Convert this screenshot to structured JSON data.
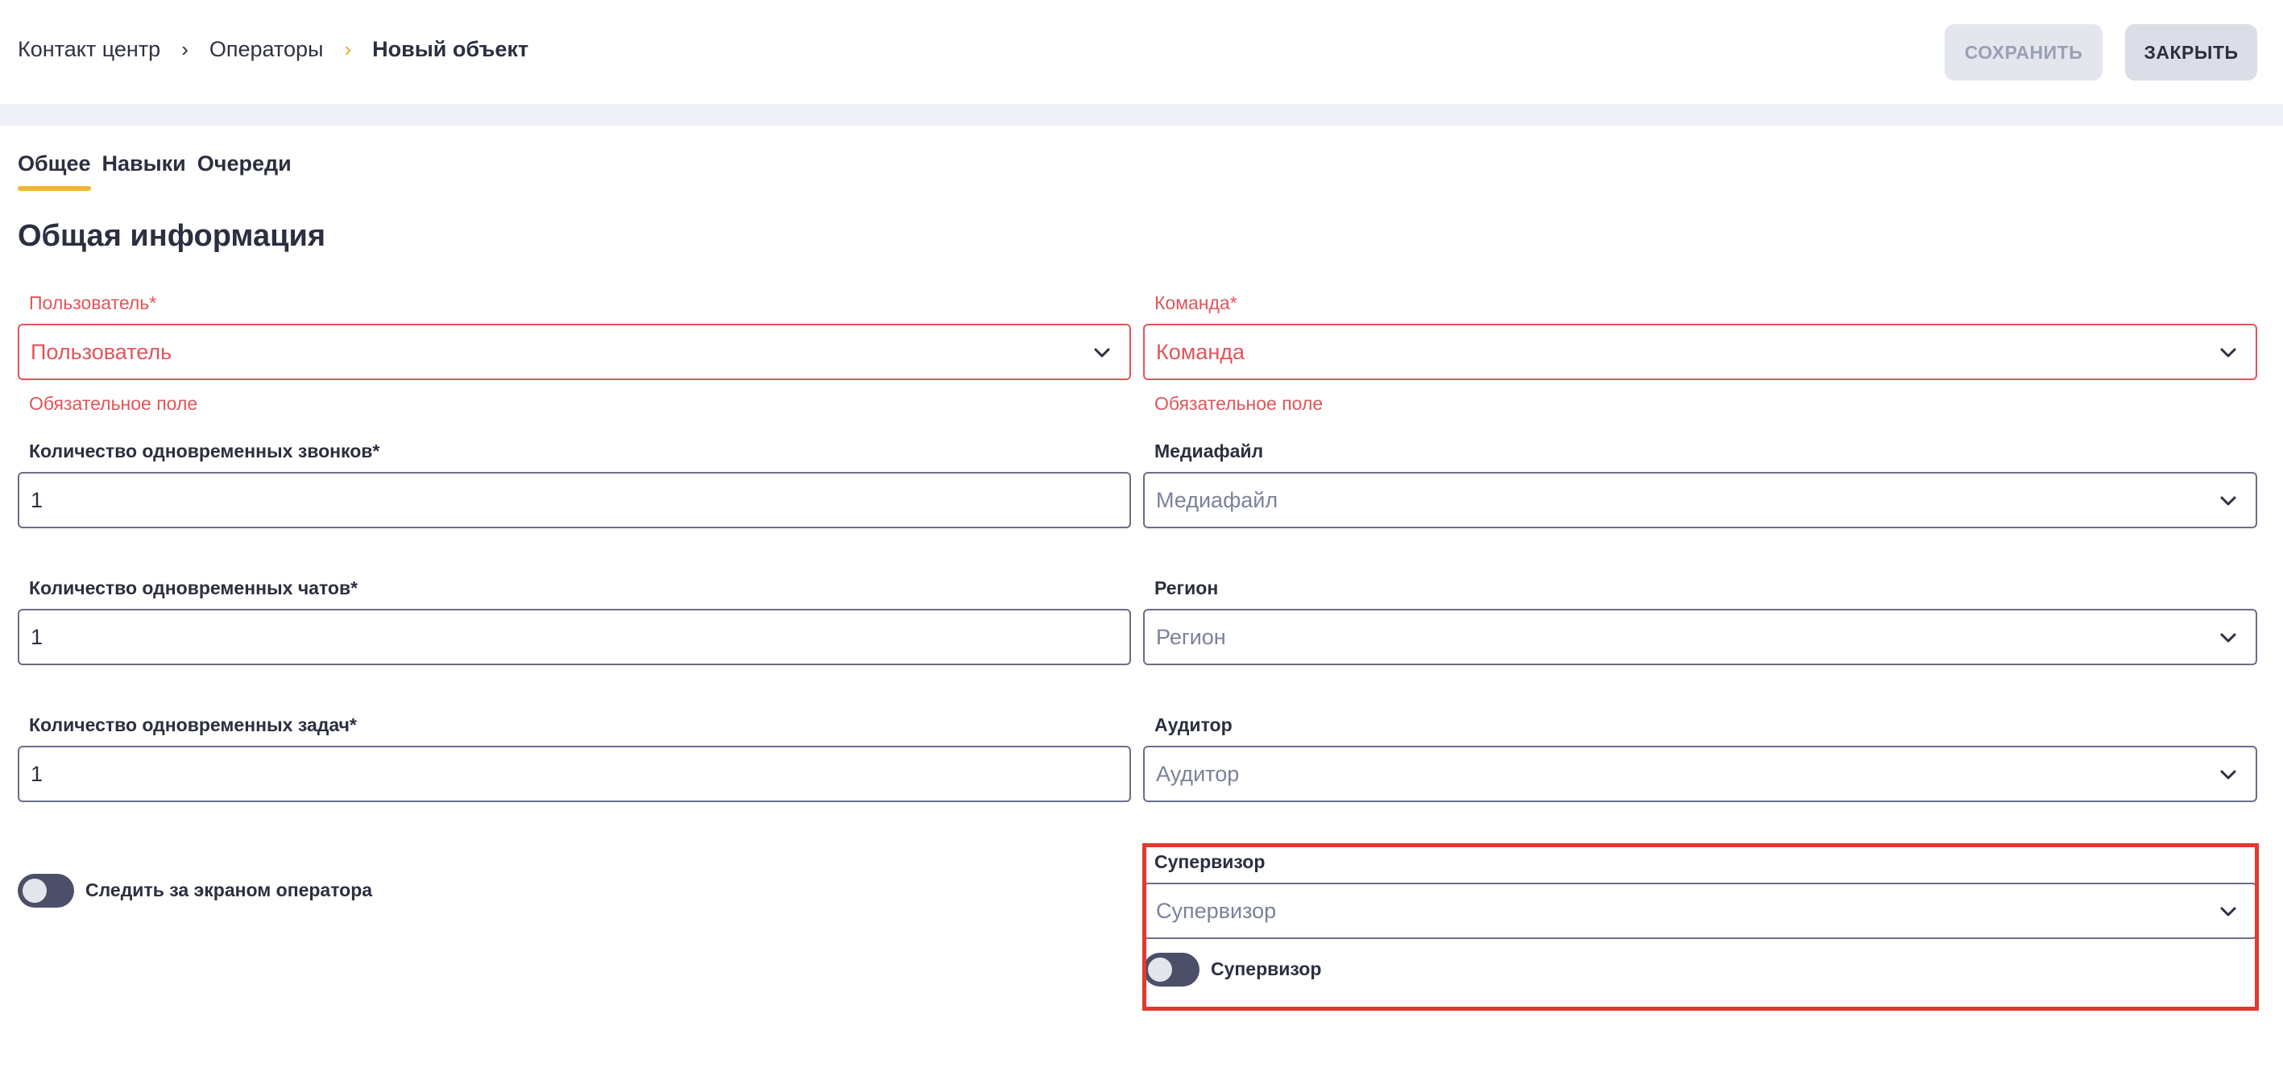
{
  "breadcrumb": {
    "root": "Контакт центр",
    "sep1": "›",
    "section": "Операторы",
    "sep2": "›",
    "current": "Новый объект"
  },
  "toolbar": {
    "save_label": "СОХРАНИТЬ",
    "close_label": "ЗАКРЫТЬ"
  },
  "tabs": [
    {
      "label": "Общее",
      "active": true
    },
    {
      "label": "Навыки",
      "active": false
    },
    {
      "label": "Очереди",
      "active": false
    }
  ],
  "section_title": "Общая информация",
  "form": {
    "user": {
      "label": "Пользователь*",
      "placeholder": "Пользователь",
      "error": "Обязательное поле"
    },
    "team": {
      "label": "Команда*",
      "placeholder": "Команда",
      "error": "Обязательное поле"
    },
    "calls": {
      "label": "Количество одновременных звонков*",
      "value": "1"
    },
    "media": {
      "label": "Медиафайл",
      "placeholder": "Медиафайл"
    },
    "chats": {
      "label": "Количество одновременных чатов*",
      "value": "1"
    },
    "region": {
      "label": "Регион",
      "placeholder": "Регион"
    },
    "tasks": {
      "label": "Количество одновременных задач*",
      "value": "1"
    },
    "auditor": {
      "label": "Аудитор",
      "placeholder": "Аудитор"
    },
    "watch_screen": {
      "label": "Следить за экраном оператора",
      "on": false
    },
    "supervisor": {
      "label": "Супервизор",
      "placeholder": "Супервизор"
    },
    "supervisor_toggle": {
      "label": "Супервизор",
      "on": false
    }
  },
  "colors": {
    "accent": "#f2b632",
    "error": "#e0555a",
    "highlight": "#e23a2e",
    "toggle": "#4b5068"
  }
}
